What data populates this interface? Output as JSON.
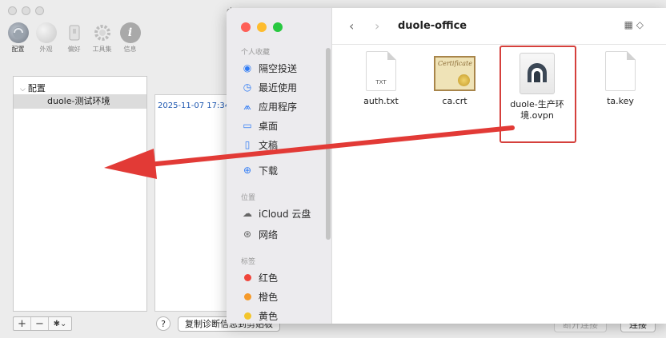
{
  "background_app": {
    "title": "d",
    "toolbar": [
      {
        "label": "配置",
        "icon": "vpn-config-icon",
        "active": true
      },
      {
        "label": "外观",
        "icon": "appearance-icon"
      },
      {
        "label": "偏好",
        "icon": "preferences-icon"
      },
      {
        "label": "工具集",
        "icon": "gear-icon"
      },
      {
        "label": "信息",
        "icon": "info-icon"
      }
    ],
    "tree": {
      "header": "配置",
      "items": [
        "duole-测试环境"
      ]
    },
    "log_line": "2025-11-07 17:34:",
    "bottom_buttons": {
      "add": "+",
      "remove": "−",
      "gear": "✱⌄"
    },
    "help": "?",
    "copy_button": "复制诊断信息到剪贴板",
    "disconnect_button": "断开连接",
    "connect_button": "连接"
  },
  "finder": {
    "nav": {
      "back": "‹",
      "forward": "›"
    },
    "title": "duole-office",
    "view_button": "▦ ◇",
    "sidebar": {
      "favorites_label": "个人收藏",
      "favorites": [
        {
          "label": "隔空投送",
          "icon": "airdrop-icon"
        },
        {
          "label": "最近使用",
          "icon": "clock-icon"
        },
        {
          "label": "应用程序",
          "icon": "applications-icon"
        },
        {
          "label": "桌面",
          "icon": "desktop-icon"
        },
        {
          "label": "文稿",
          "icon": "document-icon"
        },
        {
          "label": "下载",
          "icon": "download-icon"
        }
      ],
      "locations_label": "位置",
      "locations": [
        {
          "label": "iCloud 云盘",
          "icon": "cloud-icon"
        },
        {
          "label": "网络",
          "icon": "network-icon"
        }
      ],
      "tags_label": "标签",
      "tags": [
        {
          "label": "红色",
          "color": "#f0453b"
        },
        {
          "label": "橙色",
          "color": "#f59a2b"
        },
        {
          "label": "黄色",
          "color": "#f3c52c"
        }
      ]
    },
    "files": [
      {
        "name": "auth.txt",
        "kind": "txt",
        "ext": "TXT"
      },
      {
        "name": "ca.crt",
        "kind": "cert",
        "cert_text": "Certificate"
      },
      {
        "name": "duole-生产环境.ovpn",
        "kind": "ovpn",
        "highlighted": true
      },
      {
        "name": "ta.key",
        "kind": "key"
      }
    ]
  },
  "annotation": {
    "arrow_color": "#e23a36",
    "highlight_color": "#d5403c"
  }
}
